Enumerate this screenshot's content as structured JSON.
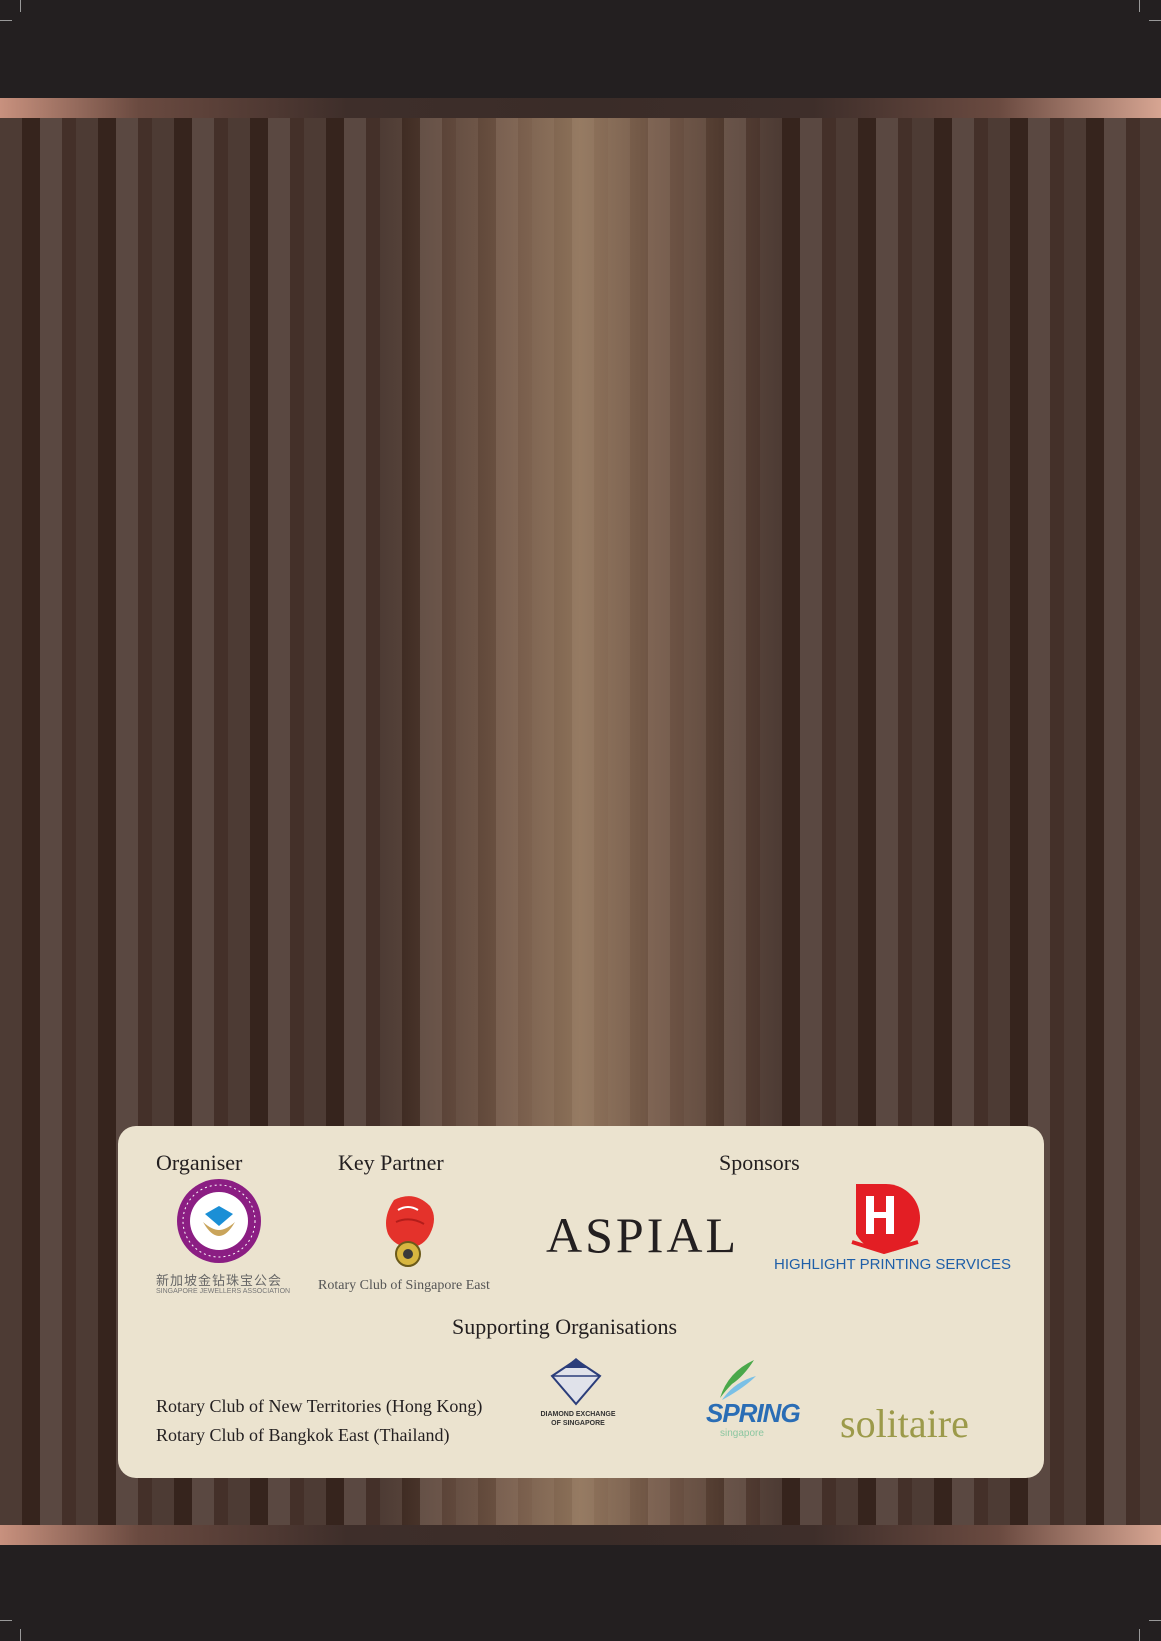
{
  "organiser": {
    "heading": "Organiser",
    "name_chinese": "新加坡金钻珠宝公会",
    "name_english": "SINGAPORE JEWELLERS ASSOCIATION",
    "logo_icon": "sja-seal-icon"
  },
  "key_partner": {
    "heading": "Key Partner",
    "name": "Rotary Club of Singapore East",
    "logo_icon": "merlion-rotary-icon"
  },
  "sponsors": {
    "heading": "Sponsors",
    "items": [
      {
        "name": "ASPIAL",
        "icon": "aspial-wordmark"
      },
      {
        "name": "HIGHLIGHT PRINTING SERVICES",
        "icon": "highlight-printing-icon"
      }
    ]
  },
  "supporting": {
    "heading": "Supporting Organisations",
    "lines": [
      "Rotary Club of New Territories (Hong Kong)",
      "Rotary Club of Bangkok East (Thailand)"
    ],
    "logos": [
      {
        "name": "DIAMOND EXCHANGE OF SINGAPORE",
        "icon": "diamond-exchange-icon"
      },
      {
        "name": "SPRING",
        "sub": "singapore",
        "icon": "spring-singapore-icon"
      },
      {
        "name": "solitaire",
        "icon": "solitaire-wordmark"
      }
    ]
  },
  "colors": {
    "background": "#231f20",
    "panel": "#ebe3cf",
    "organiser_purple": "#8b1e83",
    "highlight_red": "#e31e24",
    "highlight_blue": "#1f5fa8",
    "spring_blue": "#2a6db5",
    "solitaire_olive": "#9c9a4a"
  }
}
